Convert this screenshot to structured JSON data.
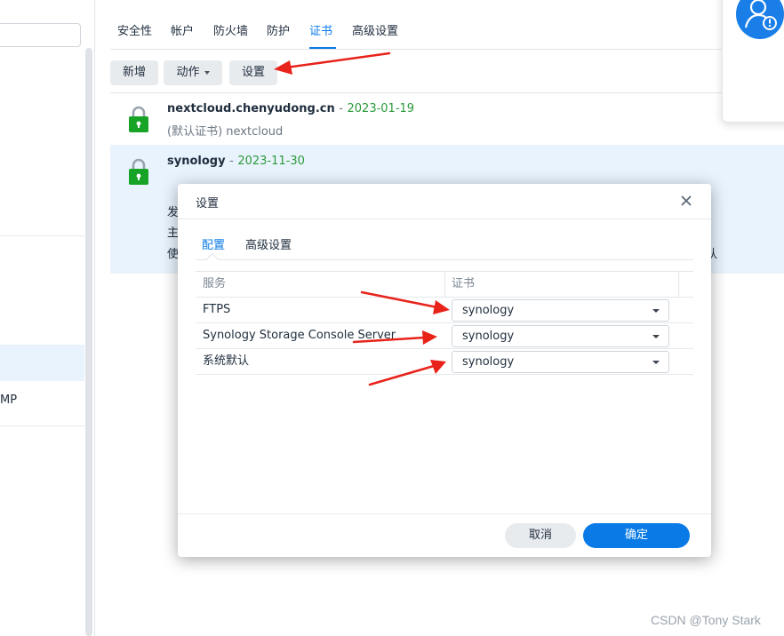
{
  "tabs": [
    {
      "label": "安全性"
    },
    {
      "label": "帐户"
    },
    {
      "label": "防火墙"
    },
    {
      "label": "防护"
    },
    {
      "label": "证书",
      "active": true
    },
    {
      "label": "高级设置"
    }
  ],
  "toolbar": {
    "add_label": "新增",
    "action_label": "动作",
    "settings_label": "设置"
  },
  "sidebar": {
    "visible_item_fragment": "MP"
  },
  "certificates": [
    {
      "name": "nextcloud.chenyudong.cn",
      "separator": "-",
      "date": "2023-01-19",
      "sub": "(默认证书) nextcloud"
    },
    {
      "name": "synology",
      "separator": "-",
      "date": "2023-11-30",
      "fragments": [
        "发",
        "主",
        "使"
      ],
      "right_fragment": "认"
    }
  ],
  "dialog": {
    "title": "设置",
    "close_icon": "close-icon",
    "tabs": [
      {
        "label": "配置",
        "active": true
      },
      {
        "label": "高级设置"
      }
    ],
    "columns": [
      "服务",
      "证书"
    ],
    "rows": [
      {
        "service": "FTPS",
        "certificate": "synology"
      },
      {
        "service": "Synology Storage Console Server",
        "certificate": "synology"
      },
      {
        "service": "系统默认",
        "certificate": "synology"
      }
    ],
    "cancel_label": "取消",
    "ok_label": "确定"
  },
  "watermark": "CSDN @Tony Stark",
  "colors": {
    "accent": "#0a7be6",
    "date_green": "#2b9a3a",
    "lock_green": "#17a326",
    "arrow_red": "#e8231a",
    "selected_row": "#e9f3fd"
  }
}
